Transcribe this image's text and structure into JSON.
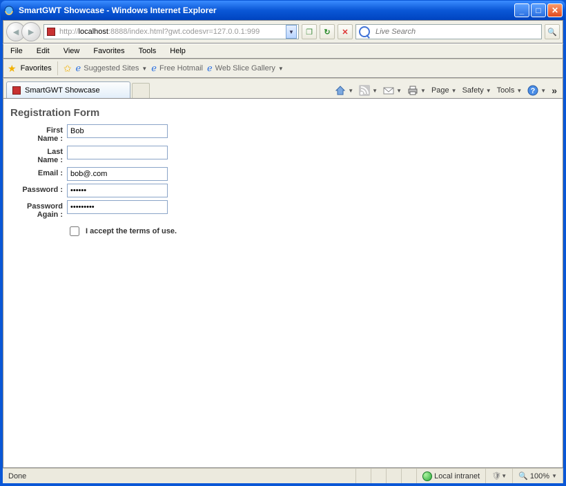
{
  "window": {
    "title": "SmartGWT Showcase - Windows Internet Explorer"
  },
  "nav": {
    "url_prefix": "http://",
    "url_host": "localhost",
    "url_rest": ":8888/index.html?gwt.codesvr=127.0.0.1:999",
    "search_placeholder": "Live Search"
  },
  "menu": {
    "items": [
      "File",
      "Edit",
      "View",
      "Favorites",
      "Tools",
      "Help"
    ]
  },
  "favbar": {
    "label": "Favorites",
    "suggested": "Suggested Sites",
    "hotmail": "Free Hotmail",
    "webslice": "Web Slice Gallery"
  },
  "tabs": {
    "active": "SmartGWT Showcase"
  },
  "commandbar": {
    "page": "Page",
    "safety": "Safety",
    "tools": "Tools"
  },
  "page": {
    "form_title": "Registration Form",
    "fields": {
      "firstname_label": "First Name :",
      "firstname_value": "Bob",
      "lastname_label": "Last Name :",
      "lastname_value": "",
      "email_label": "Email :",
      "email_value": "bob@.com",
      "password_label": "Password :",
      "password_value": "••••••",
      "password2_label": "Password Again :",
      "password2_value": "•••••••••",
      "terms_label": "I accept the terms of use."
    }
  },
  "status": {
    "done": "Done",
    "zone": "Local intranet",
    "zoom": "100%"
  }
}
